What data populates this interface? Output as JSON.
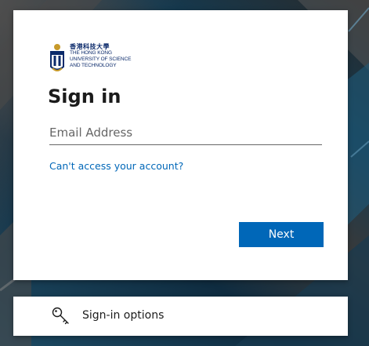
{
  "colors": {
    "accent": "#0067b8",
    "title_text": "#1b1b1b",
    "logo_navy": "#0b2a6b",
    "logo_gold": "#c79a2b"
  },
  "logo": {
    "name_cn": "香港科技大學",
    "name_en_line1": "THE HONG KONG",
    "name_en_line2": "UNIVERSITY OF SCIENCE",
    "name_en_line3": "AND TECHNOLOGY",
    "icon": "hkust-crest-icon"
  },
  "signin": {
    "title": "Sign in",
    "email_placeholder": "Email Address",
    "email_value": "",
    "cant_access_link": "Can't access your account?",
    "next_button": "Next"
  },
  "options": {
    "label": "Sign-in options",
    "icon": "key-icon"
  }
}
